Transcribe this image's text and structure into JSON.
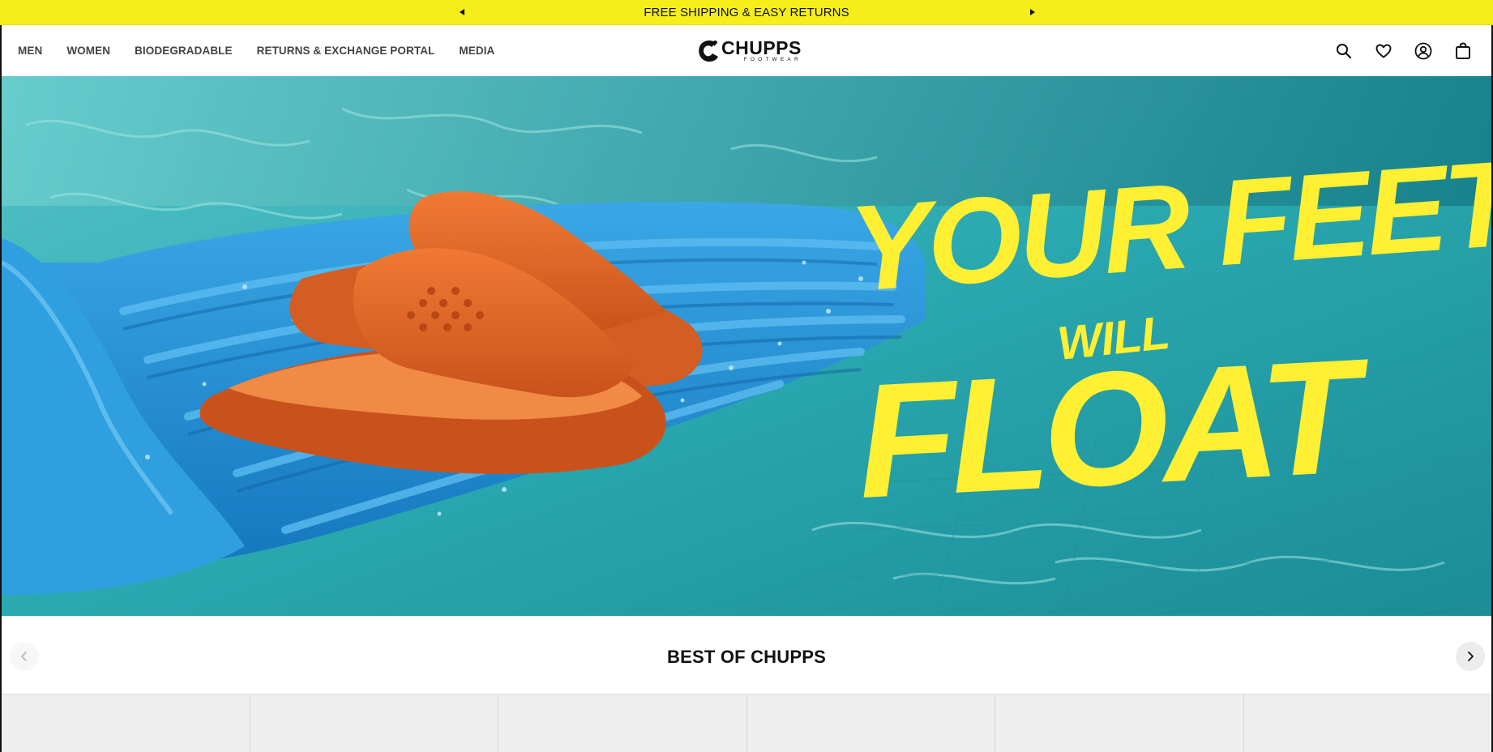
{
  "announcement": {
    "text": "FREE SHIPPING & EASY RETURNS",
    "prev_icon": "triangle-left-icon",
    "next_icon": "triangle-right-icon",
    "bg_color": "#f5ee1a"
  },
  "nav": {
    "items": [
      {
        "label": "MEN"
      },
      {
        "label": "WOMEN"
      },
      {
        "label": "BIODEGRADABLE"
      },
      {
        "label": "RETURNS & EXCHANGE PORTAL"
      },
      {
        "label": "MEDIA"
      }
    ]
  },
  "logo": {
    "brand": "CHUPPS",
    "tagline": "FOOTWEAR"
  },
  "header_icons": [
    "search-icon",
    "heart-icon",
    "account-icon",
    "bag-icon"
  ],
  "hero": {
    "headline_line1": "YOUR FEET",
    "headline_line2": "WILL",
    "headline_line3": "FLOAT",
    "text_color": "#fff033",
    "sandal_color": "#e9682b",
    "float_color": "#1f8fd6",
    "water_color": "#2aa8b0"
  },
  "best_section": {
    "title": "BEST OF CHUPPS",
    "prev_icon": "chevron-left-icon",
    "next_icon": "chevron-right-icon"
  },
  "product_tiles": [
    {},
    {},
    {},
    {},
    {},
    {}
  ]
}
